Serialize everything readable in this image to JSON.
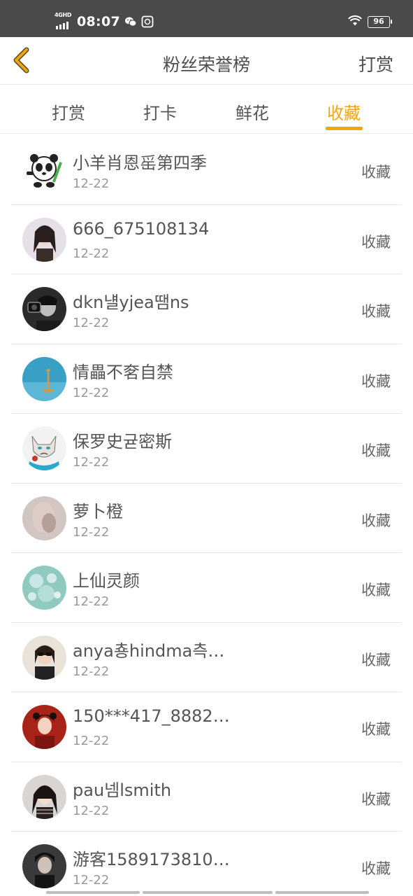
{
  "status_bar": {
    "network": "4GHD",
    "time": "08:07",
    "battery": "96"
  },
  "header": {
    "title": "粉丝荣誉榜",
    "action_label": "打赏"
  },
  "tabs": [
    {
      "label": "打赏"
    },
    {
      "label": "打卡"
    },
    {
      "label": "鲜花"
    },
    {
      "label": "收藏"
    }
  ],
  "active_tab": "收藏",
  "accent_color": "#f0a614",
  "list": [
    {
      "name": "小羊肖恩䍃第四季",
      "date": "12-22",
      "action": "收藏"
    },
    {
      "name": "666_675108134",
      "date": "12-22",
      "action": "收藏"
    },
    {
      "name": "dkn냴yjea땜ns",
      "date": "12-22",
      "action": "收藏"
    },
    {
      "name": "情畾不㚚自禁",
      "date": "12-22",
      "action": "收藏"
    },
    {
      "name": "保罗史귣密斯",
      "date": "12-22",
      "action": "收藏"
    },
    {
      "name": "萝卜橙",
      "date": "12-22",
      "action": "收藏"
    },
    {
      "name": "上仙灵颜",
      "date": "12-22",
      "action": "收藏"
    },
    {
      "name": "anya춍hindma측…",
      "date": "12-22",
      "action": "收藏"
    },
    {
      "name": "150***417_8882…",
      "date": "12-22",
      "action": "收藏"
    },
    {
      "name": "pau넴lsmith",
      "date": "12-22",
      "action": "收藏"
    },
    {
      "name": "游客1589173810…",
      "date": "12-22",
      "action": "收藏"
    }
  ]
}
